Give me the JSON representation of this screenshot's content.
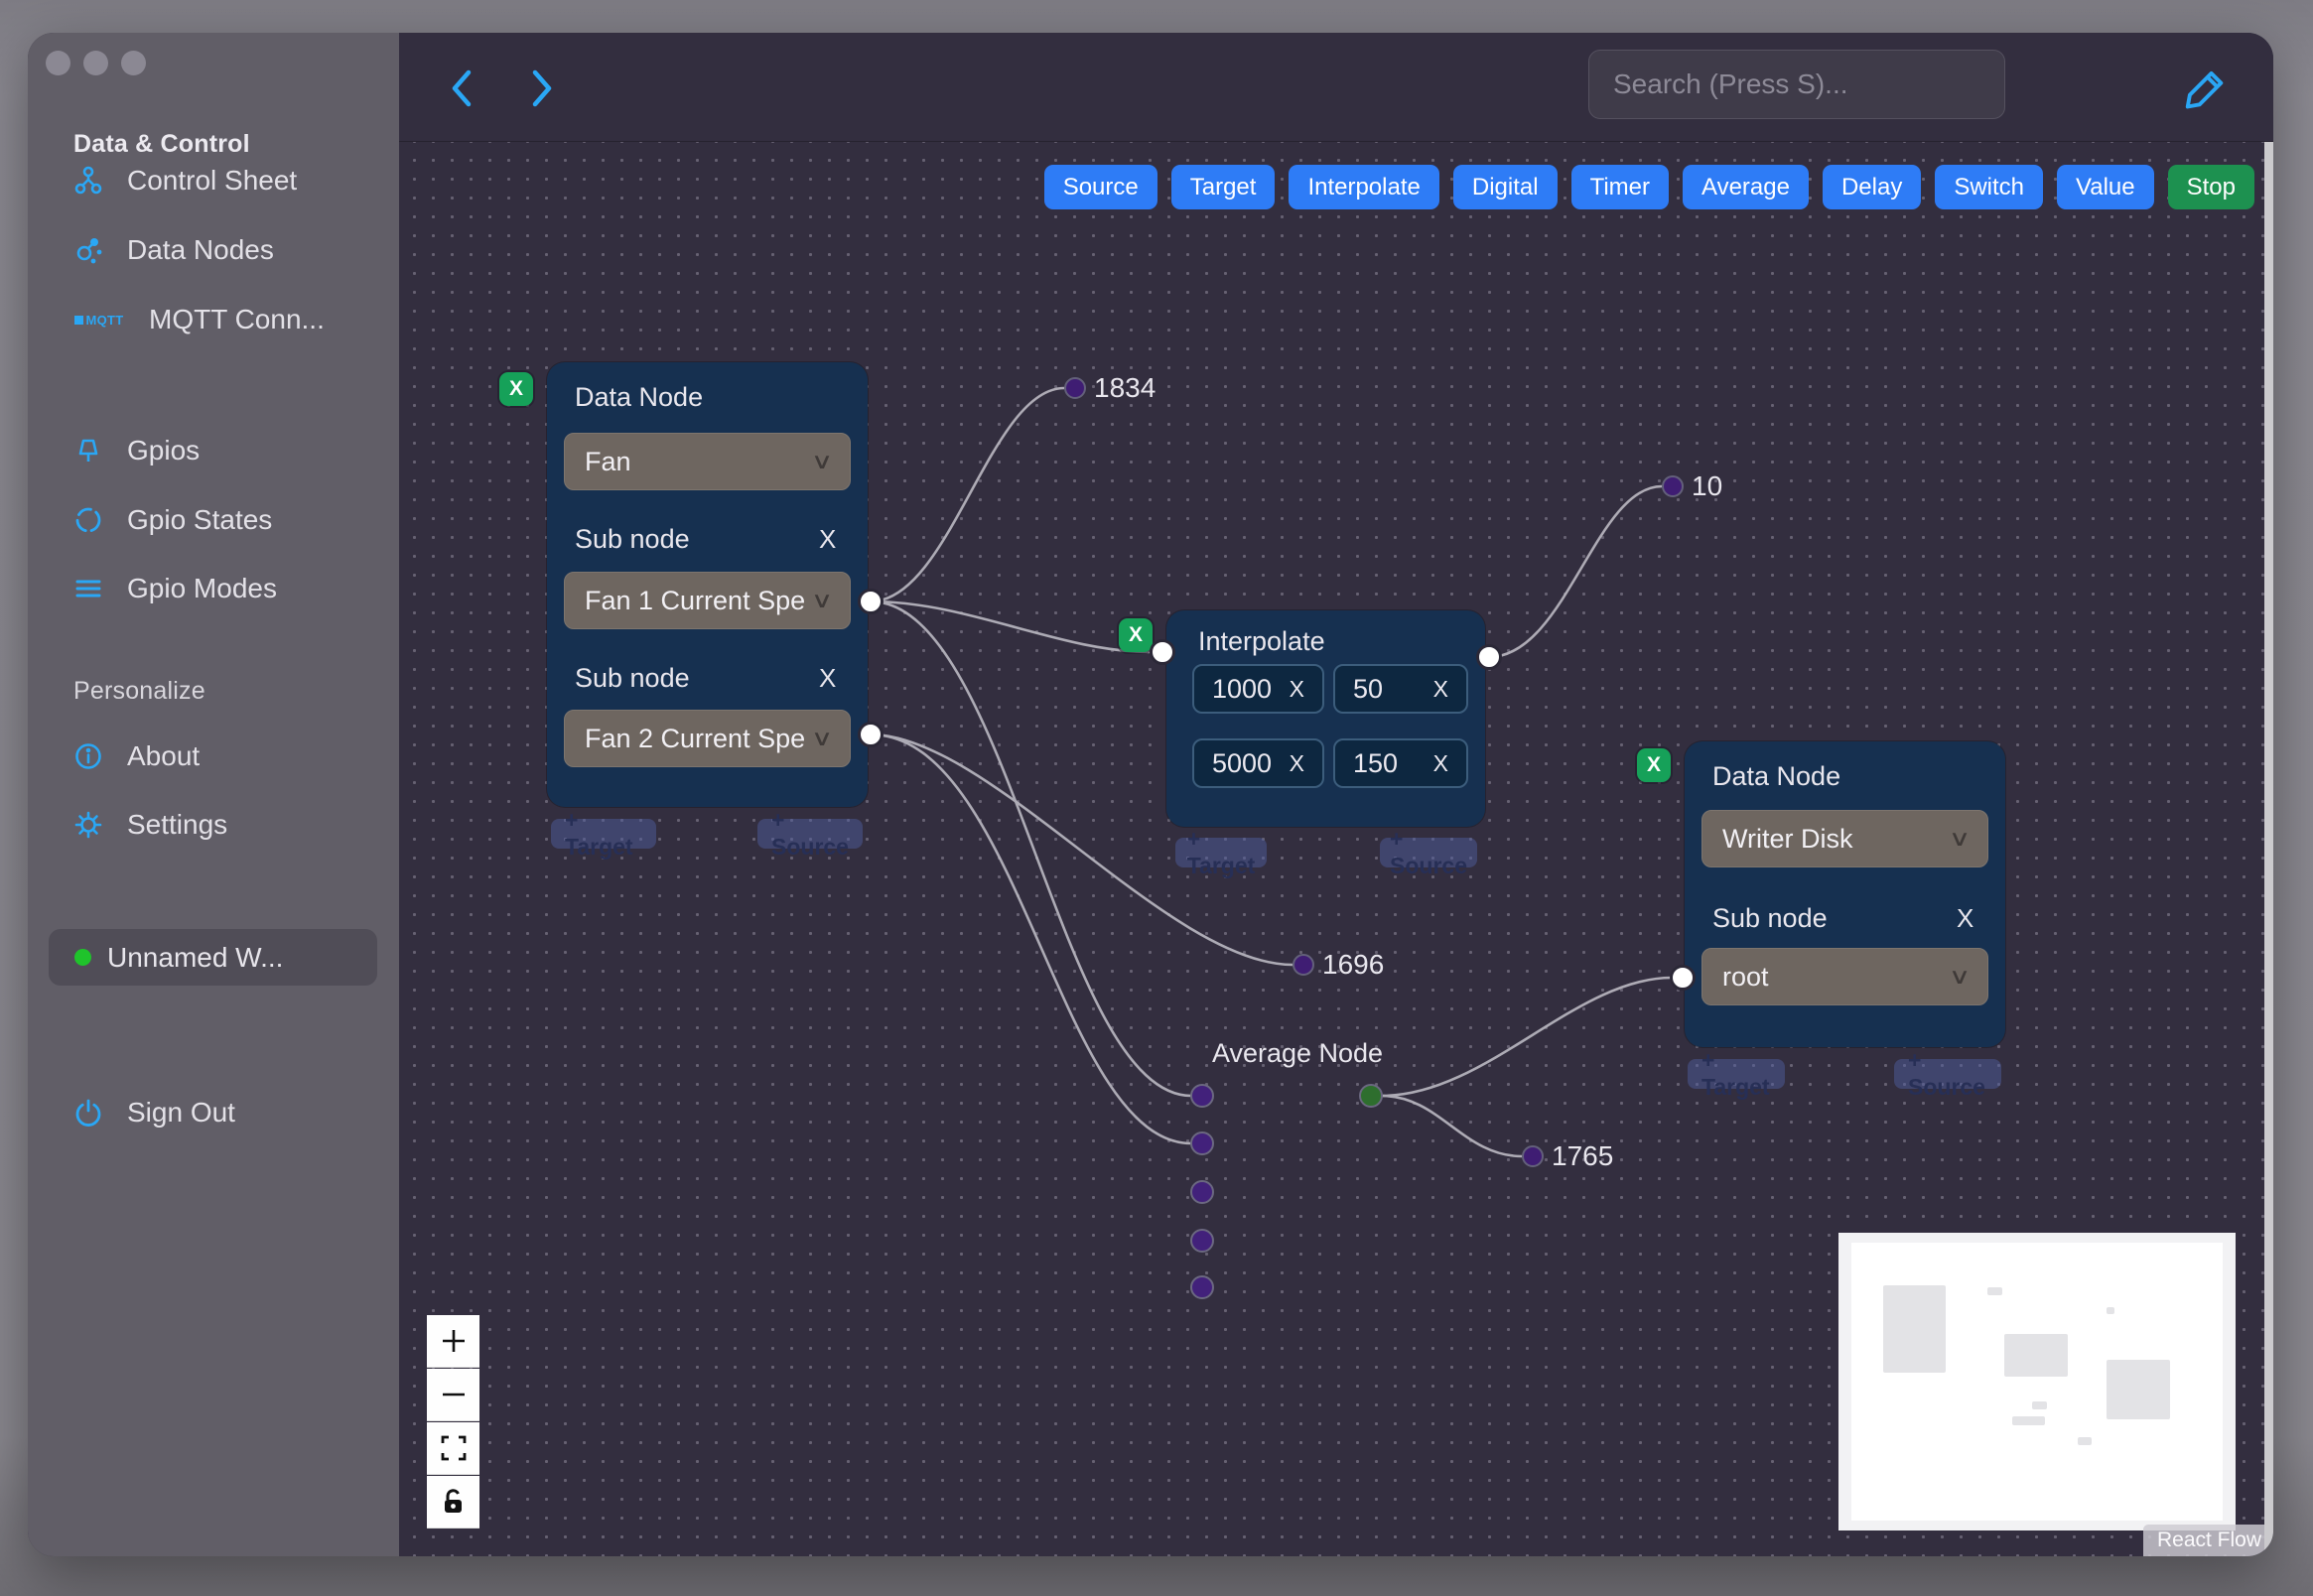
{
  "sidebar": {
    "header": "Data & Control",
    "items_data": [
      {
        "label": "Control Sheet",
        "icon": "workflow-icon"
      },
      {
        "label": "Data Nodes",
        "icon": "cluster-icon"
      },
      {
        "label": "MQTT Conn...",
        "icon": "mqtt-icon"
      }
    ],
    "items_gpio": [
      {
        "label": "Gpios",
        "icon": "pin-icon"
      },
      {
        "label": "Gpio States",
        "icon": "dashed-circle-icon"
      },
      {
        "label": "Gpio Modes",
        "icon": "lines-icon"
      }
    ],
    "personalize_header": "Personalize",
    "items_personalize": [
      {
        "label": "About",
        "icon": "info-icon"
      },
      {
        "label": "Settings",
        "icon": "gear-icon"
      }
    ],
    "workspace_label": "Unnamed W...",
    "signout_label": "Sign Out"
  },
  "topbar": {
    "search_placeholder": "Search (Press S)...",
    "mqtt_icon_text": "MQTT"
  },
  "palette": {
    "buttons": [
      {
        "label": "Source",
        "color": "#2e7cf6"
      },
      {
        "label": "Target",
        "color": "#2e7cf6"
      },
      {
        "label": "Interpolate",
        "color": "#2e7cf6"
      },
      {
        "label": "Digital",
        "color": "#2e7cf6"
      },
      {
        "label": "Timer",
        "color": "#2e7cf6"
      },
      {
        "label": "Average",
        "color": "#2e7cf6"
      },
      {
        "label": "Delay",
        "color": "#2e7cf6"
      },
      {
        "label": "Switch",
        "color": "#2e7cf6"
      },
      {
        "label": "Value",
        "color": "#2e7cf6"
      },
      {
        "label": "Stop",
        "color": "#1d9150"
      }
    ]
  },
  "ui": {
    "x": "X",
    "plus_target": "+ Target",
    "plus_source": "+ Source",
    "zoom_in": "+",
    "zoom_out": "−",
    "attribution": "React Flow"
  },
  "nodes": {
    "fan": {
      "title": "Data Node",
      "type_value": "Fan",
      "sub1_label": "Sub node",
      "sub1_value": "Fan 1 Current Spe",
      "sub2_label": "Sub node",
      "sub2_value": "Fan 2 Current Spe"
    },
    "interpolate": {
      "title": "Interpolate",
      "v1": "1000",
      "v2": "50",
      "v3": "5000",
      "v4": "150"
    },
    "writer": {
      "title": "Data Node",
      "type_value": "Writer Disk",
      "sub_label": "Sub node",
      "sub_value": "root"
    },
    "average": {
      "title": "Average Node"
    }
  },
  "edge_labels": {
    "l1834": "1834",
    "l10": "10",
    "l1696": "1696",
    "l1765": "1765"
  },
  "colors": {
    "accent_blue": "#2aa7f5",
    "button_blue": "#2e7cf6",
    "button_green": "#1d9150",
    "node_bg": "#163050",
    "handle_purple": "#42217b",
    "handle_green": "#2e6e2e",
    "workspace_status": "#1fc32b"
  }
}
